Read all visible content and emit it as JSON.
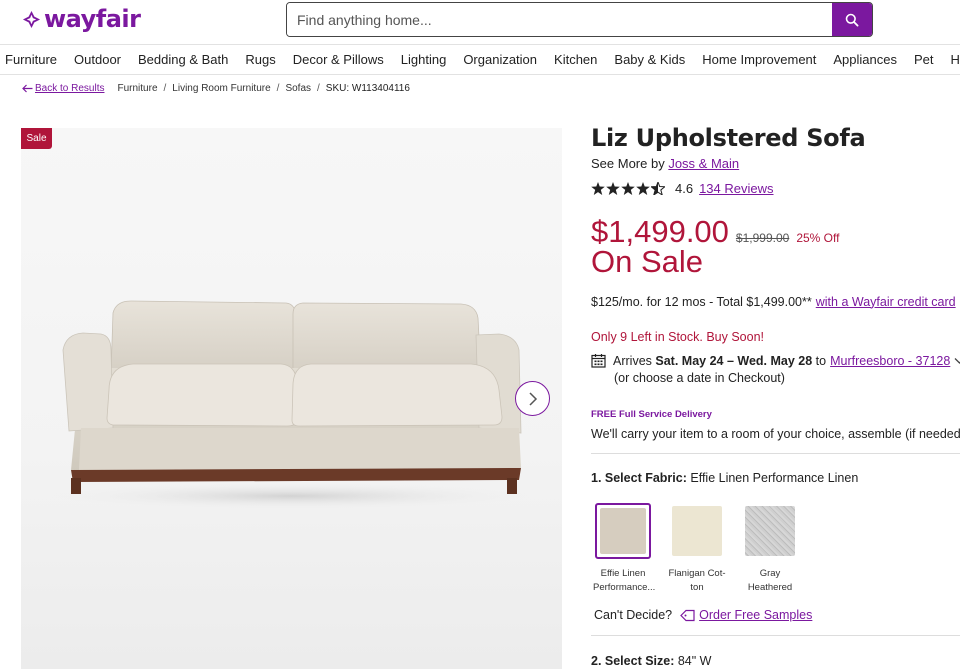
{
  "header": {
    "logo_text": "wayfair",
    "search_placeholder": "Find anything home...",
    "brand_color": "#7b189f"
  },
  "nav": {
    "items": [
      "Furniture",
      "Outdoor",
      "Bedding & Bath",
      "Rugs",
      "Decor & Pillows",
      "Lighting",
      "Organization",
      "Kitchen",
      "Baby & Kids",
      "Home Improvement",
      "Appliances",
      "Pet",
      "Holiday"
    ]
  },
  "breadcrumb": {
    "back_label": "Back to Results",
    "crumbs": [
      "Furniture",
      "Living Room Furniture",
      "Sofas"
    ],
    "sku": "SKU: W113404116"
  },
  "gallery": {
    "badge": "Sale",
    "badge_color": "#b0153a"
  },
  "product": {
    "title": "Liz Upholstered Sofa",
    "see_more_prefix": "See More by",
    "brand": "Joss & Main",
    "rating": "4.6",
    "rating_value": 4.6,
    "reviews": "134 Reviews",
    "price": "$1,499.00",
    "original_price": "$1,999.00",
    "discount": "25% Off",
    "on_sale": "On Sale",
    "sale_color": "#b0153a",
    "finance_text": "$125/mo. for 12 mos - Total $1,499.00**",
    "finance_link": "with a Wayfair credit card",
    "stock": "Only 9 Left in Stock. Buy Soon!",
    "arrives_prefix": "Arrives",
    "arrives_dates": "Sat. May 24 – Wed. May 28",
    "arrives_to": "to",
    "zip_link": "Murfreesboro - 37128",
    "arrives_sub": "(or choose a date in Checkout)",
    "delivery_tag": "FREE Full Service Delivery",
    "delivery_text": "We'll carry your item to a room of your choice, assemble (if needed), a",
    "fabric_label": "1. Select Fabric:",
    "fabric_value": "Effie Linen Performance Linen",
    "swatches": [
      {
        "name_line1": "Effie Linen",
        "name_line2": "Performance...",
        "color": "#d6cdbf",
        "selected": true
      },
      {
        "name_line1": "Flanigan Cot-",
        "name_line2": "ton",
        "color": "#ece6d2",
        "selected": false
      },
      {
        "name_line1": "Gray",
        "name_line2": "Heathered",
        "color": "#c7c7c7",
        "selected": false
      }
    ],
    "cant_decide": "Can't Decide?",
    "samples_link": "Order Free Samples",
    "size_label": "2. Select Size:",
    "size_value": "84\" W"
  }
}
